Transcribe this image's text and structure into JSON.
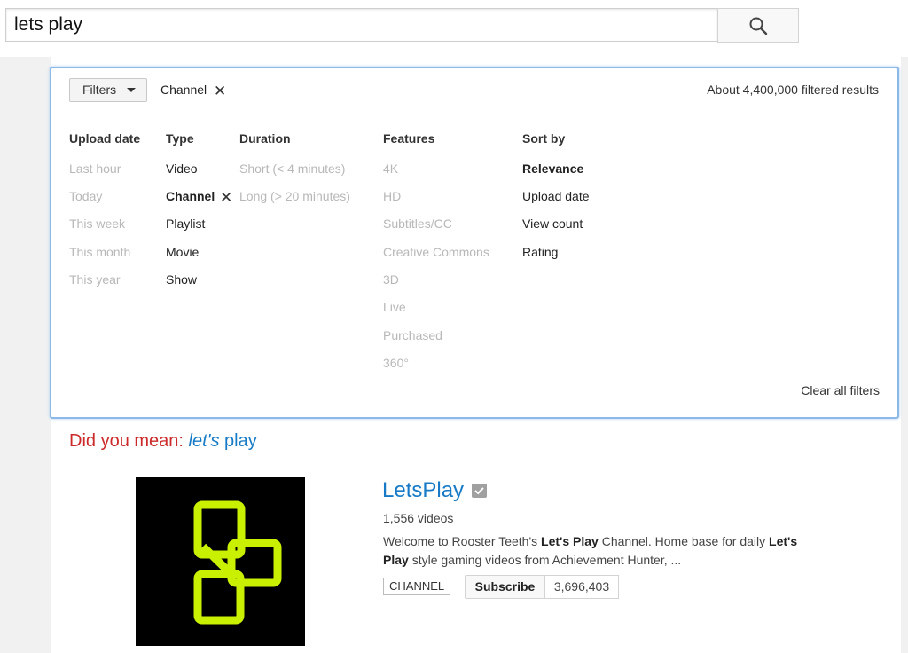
{
  "search": {
    "query": "lets play"
  },
  "filters": {
    "button_label": "Filters",
    "active_chip": "Channel",
    "results_count": "About 4,400,000 filtered results",
    "clear_all": "Clear all filters",
    "columns": [
      {
        "heading": "Upload date",
        "options": [
          {
            "label": "Last hour",
            "state": "disabled"
          },
          {
            "label": "Today",
            "state": "disabled"
          },
          {
            "label": "This week",
            "state": "disabled"
          },
          {
            "label": "This month",
            "state": "disabled"
          },
          {
            "label": "This year",
            "state": "disabled"
          }
        ]
      },
      {
        "heading": "Type",
        "options": [
          {
            "label": "Video",
            "state": "enabled"
          },
          {
            "label": "Channel",
            "state": "selected"
          },
          {
            "label": "Playlist",
            "state": "enabled"
          },
          {
            "label": "Movie",
            "state": "enabled"
          },
          {
            "label": "Show",
            "state": "enabled"
          }
        ]
      },
      {
        "heading": "Duration",
        "options": [
          {
            "label": "Short (< 4 minutes)",
            "state": "disabled"
          },
          {
            "label": "Long (> 20 minutes)",
            "state": "disabled"
          }
        ]
      },
      {
        "heading": "Features",
        "options": [
          {
            "label": "4K",
            "state": "disabled"
          },
          {
            "label": "HD",
            "state": "disabled"
          },
          {
            "label": "Subtitles/CC",
            "state": "disabled"
          },
          {
            "label": "Creative Commons",
            "state": "disabled"
          },
          {
            "label": "3D",
            "state": "disabled"
          },
          {
            "label": "Live",
            "state": "disabled"
          },
          {
            "label": "Purchased",
            "state": "disabled"
          },
          {
            "label": "360°",
            "state": "disabled"
          }
        ]
      },
      {
        "heading": "Sort by",
        "options": [
          {
            "label": "Relevance",
            "state": "selected"
          },
          {
            "label": "Upload date",
            "state": "enabled"
          },
          {
            "label": "View count",
            "state": "enabled"
          },
          {
            "label": "Rating",
            "state": "enabled"
          }
        ]
      }
    ]
  },
  "suggestion": {
    "prefix": "Did you mean: ",
    "term_italic": "let's",
    "term_rest": " play"
  },
  "result": {
    "title": "LetsPlay",
    "video_count": "1,556 videos",
    "description": {
      "part1": "Welcome to Rooster Teeth's ",
      "bold1": "Let's Play",
      "part2": " Channel. Home base for daily ",
      "bold2": "Let's",
      "bold3": "Play",
      "part3": " style gaming videos from Achievement Hunter, ..."
    },
    "badge": "CHANNEL",
    "subscribe_label": "Subscribe",
    "subscriber_count": "3,696,403"
  },
  "colors": {
    "accent_link": "#167ac6",
    "suggestion_red": "#cc2a2a",
    "panel_border": "#8cb9e8",
    "logo_green": "#c8f000"
  },
  "icons": {
    "search": "search-icon",
    "remove_filter": "close-icon",
    "dropdown": "caret-down-icon",
    "verified": "verified-badge-icon"
  }
}
